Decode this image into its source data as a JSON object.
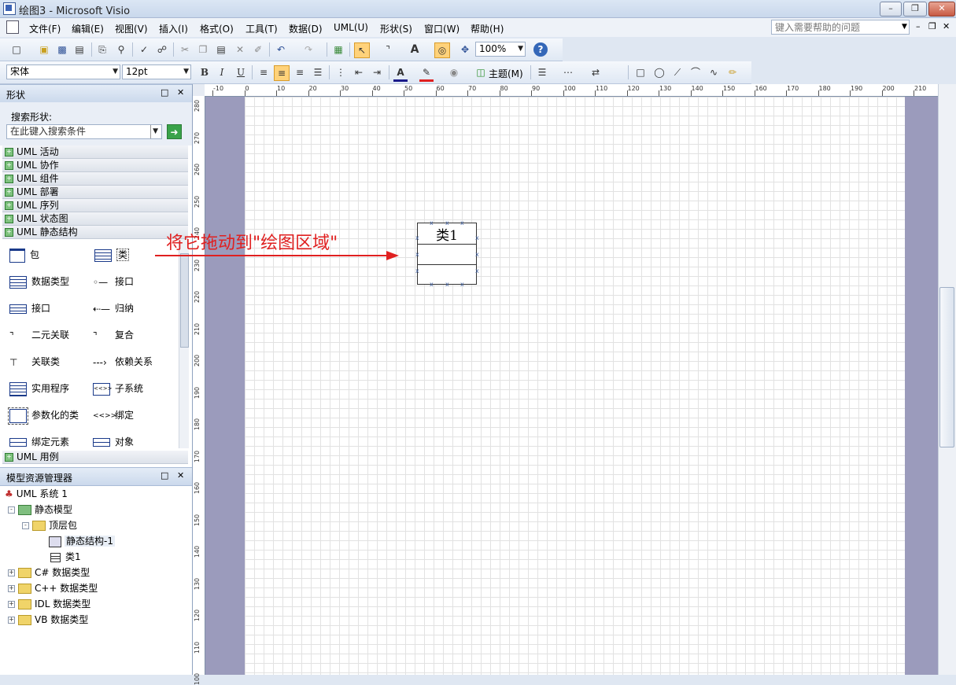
{
  "window": {
    "title": "绘图3 - Microsoft Visio",
    "app_icon": "visio-icon"
  },
  "menu": {
    "items": [
      "文件(F)",
      "编辑(E)",
      "视图(V)",
      "插入(I)",
      "格式(O)",
      "工具(T)",
      "数据(D)",
      "UML(U)",
      "形状(S)",
      "窗口(W)",
      "帮助(H)"
    ],
    "help_placeholder": "键入需要帮助的问题"
  },
  "toolbar": {
    "zoom": "100%",
    "font": "宋体",
    "font_size": "12pt",
    "bold": "B",
    "italic": "I",
    "underline": "U",
    "theme_label": "主题(M)",
    "text_tool": "A"
  },
  "shapes_pane": {
    "title": "形状",
    "search_label": "搜索形状:",
    "search_placeholder": "在此键入搜索条件",
    "categories": [
      "UML 活动",
      "UML 协作",
      "UML 组件",
      "UML 部署",
      "UML 序列",
      "UML 状态图",
      "UML 静态结构"
    ],
    "items": [
      {
        "label": "包",
        "icon": "package-icon"
      },
      {
        "label": "类",
        "icon": "class-icon"
      },
      {
        "label": "数据类型",
        "icon": "datatype-icon"
      },
      {
        "label": "接口",
        "icon": "interface-lollipop-icon"
      },
      {
        "label": "接口",
        "icon": "interface-icon"
      },
      {
        "label": "归纳",
        "icon": "generalization-icon"
      },
      {
        "label": "二元关联",
        "icon": "binary-association-icon"
      },
      {
        "label": "复合",
        "icon": "composition-icon"
      },
      {
        "label": "关联类",
        "icon": "association-class-icon"
      },
      {
        "label": "依赖关系",
        "icon": "dependency-icon"
      },
      {
        "label": "实用程序",
        "icon": "utility-icon"
      },
      {
        "label": "子系统",
        "icon": "subsystem-icon"
      },
      {
        "label": "参数化的类",
        "icon": "parameterized-class-icon"
      },
      {
        "label": "绑定",
        "icon": "binding-icon"
      },
      {
        "label": "绑定元素",
        "icon": "bound-element-icon"
      },
      {
        "label": "对象",
        "icon": "object-icon"
      }
    ],
    "last_category": "UML 用例"
  },
  "model_explorer": {
    "title": "模型资源管理器",
    "tree": [
      {
        "label": "UML 系统 1"
      },
      {
        "label": "静态模型"
      },
      {
        "label": "顶层包"
      },
      {
        "label": "静态结构-1"
      },
      {
        "label": "类1"
      },
      {
        "label": "C# 数据类型"
      },
      {
        "label": "C++ 数据类型"
      },
      {
        "label": "IDL 数据类型"
      },
      {
        "label": "VB 数据类型"
      }
    ]
  },
  "rulers": {
    "top": [
      "-10",
      "0",
      "10",
      "20",
      "30",
      "40",
      "50",
      "60",
      "70",
      "80",
      "90",
      "100",
      "110",
      "120",
      "130",
      "140",
      "150",
      "160",
      "170",
      "180",
      "190",
      "200",
      "210"
    ],
    "left": [
      "280",
      "270",
      "260",
      "250",
      "240",
      "230",
      "220",
      "210",
      "200",
      "190",
      "180",
      "170",
      "160",
      "150",
      "140",
      "130",
      "120",
      "110",
      "100"
    ]
  },
  "drawing": {
    "class_name": "类1",
    "annotation": "将它拖动到\"绘图区域\"",
    "annotation_color": "#e02020"
  }
}
